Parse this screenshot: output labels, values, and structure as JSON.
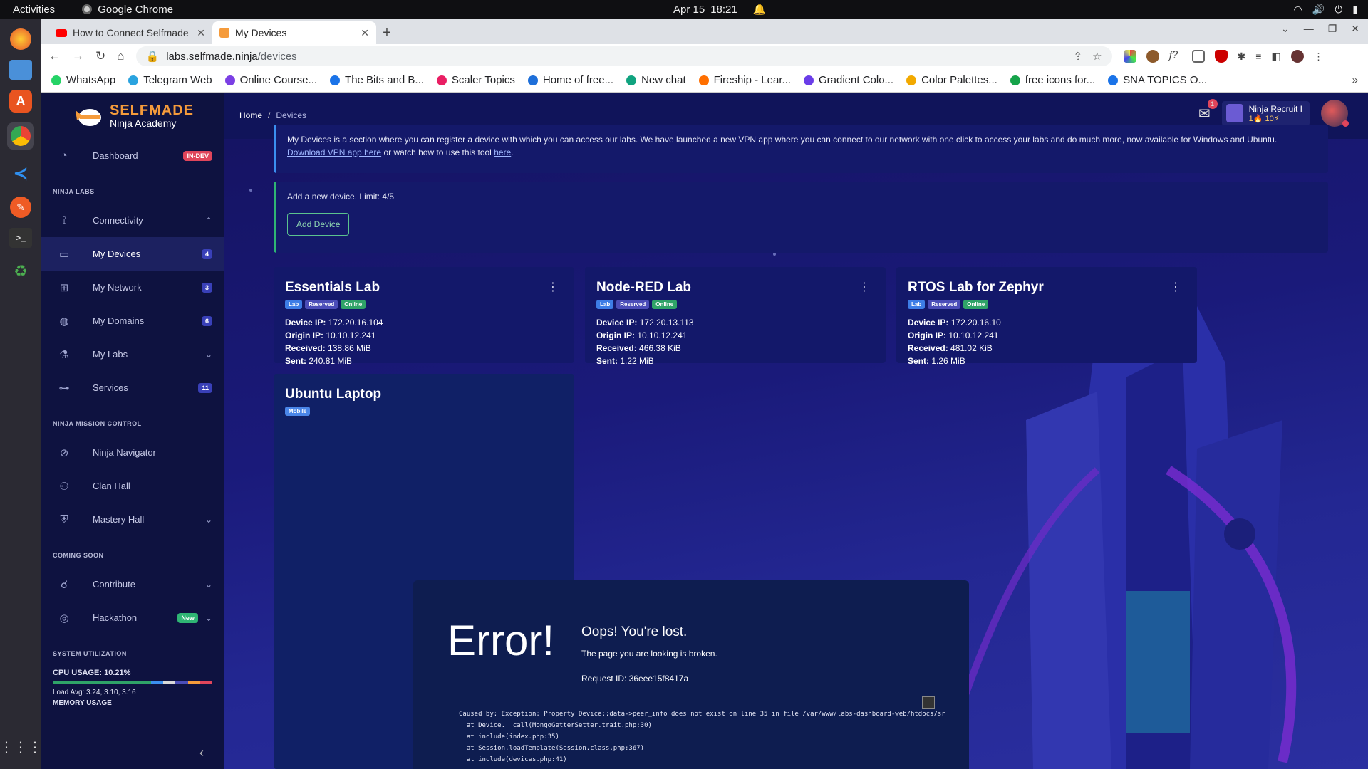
{
  "os": {
    "activities": "Activities",
    "app_name": "Google Chrome",
    "date": "Apr 15",
    "time": "18:21"
  },
  "browser": {
    "tabs": [
      {
        "title": "How to Connect Selfmade",
        "active": false
      },
      {
        "title": "My Devices",
        "active": true
      }
    ],
    "url_host": "labs.selfmade.ninja",
    "url_path": "/devices",
    "bookmarks": [
      {
        "label": "WhatsApp",
        "color": "#25d366"
      },
      {
        "label": "Telegram Web",
        "color": "#2aa3df"
      },
      {
        "label": "Online Course...",
        "color": "#7b3fe4"
      },
      {
        "label": "The Bits and B...",
        "color": "#1a73e8"
      },
      {
        "label": "Scaler Topics",
        "color": "#e91e63"
      },
      {
        "label": "Home of free...",
        "color": "#1e6fd9"
      },
      {
        "label": "New chat",
        "color": "#10a37f"
      },
      {
        "label": "Fireship - Lear...",
        "color": "#ff6f00"
      },
      {
        "label": "Gradient Colo...",
        "color": "#6a3de8"
      },
      {
        "label": "Color Palettes...",
        "color": "#f2a900"
      },
      {
        "label": "free icons for...",
        "color": "#16a34a"
      },
      {
        "label": "SNA TOPICS O...",
        "color": "#1a73e8"
      }
    ]
  },
  "brand": {
    "line1": "SELFMADE",
    "line2": "Ninja Academy"
  },
  "sidebar": {
    "dashboard": {
      "label": "Dashboard",
      "badge": "IN-DEV"
    },
    "section_labs": "NINJA LABS",
    "labs_items": [
      {
        "label": "Connectivity",
        "badge": "",
        "chevron": "⌃"
      },
      {
        "label": "My Devices",
        "badge": "4",
        "chevron": ""
      },
      {
        "label": "My Network",
        "badge": "3",
        "chevron": ""
      },
      {
        "label": "My Domains",
        "badge": "6",
        "chevron": ""
      },
      {
        "label": "My Labs",
        "badge": "",
        "chevron": "⌄"
      },
      {
        "label": "Services",
        "badge": "11",
        "chevron": ""
      }
    ],
    "section_mission": "NINJA MISSION CONTROL",
    "mission_items": [
      {
        "label": "Ninja Navigator"
      },
      {
        "label": "Clan Hall"
      },
      {
        "label": "Mastery Hall"
      }
    ],
    "section_soon": "COMING SOON",
    "soon_items": [
      {
        "label": "Contribute",
        "badge": ""
      },
      {
        "label": "Hackathon",
        "badge": "New"
      }
    ],
    "section_util": "SYSTEM UTILIZATION",
    "cpu_usage": "CPU USAGE: 10.21%",
    "load_avg": "Load Avg: 3.24, 3.10, 3.16",
    "memory": "MEMORY USAGE"
  },
  "header": {
    "crumb_home": "Home",
    "crumb_current": "Devices",
    "mail_count": "1",
    "rank_title": "Ninja Recruit I",
    "rank_stats": "1🔥 10⚡"
  },
  "info": {
    "text": "My Devices is a section where you can register a device with which you can access our labs. We have launched a new VPN app where you can connect to our network with one click to access your labs and do much more, now available for Windows and Ubuntu.",
    "link1": "Download VPN app here",
    "mid": "or watch how to use this tool",
    "link2": "here",
    "end": "."
  },
  "add_device": {
    "text": "Add a new device. Limit: 4/5",
    "button": "Add Device"
  },
  "devices": [
    {
      "name": "Essentials Lab",
      "tags": [
        "Lab",
        "Reserved",
        "Online"
      ],
      "device_ip": "172.20.16.104",
      "origin_ip": "10.10.12.241",
      "received": "138.86 MiB",
      "sent": "240.81 MiB"
    },
    {
      "name": "Node-RED Lab",
      "tags": [
        "Lab",
        "Reserved",
        "Online"
      ],
      "device_ip": "172.20.13.113",
      "origin_ip": "10.10.12.241",
      "received": "466.38 KiB",
      "sent": "1.22 MiB"
    },
    {
      "name": "RTOS Lab for Zephyr",
      "tags": [
        "Lab",
        "Reserved",
        "Online"
      ],
      "device_ip": "172.20.16.10",
      "origin_ip": "10.10.12.241",
      "received": "481.02 KiB",
      "sent": "1.26 MiB"
    },
    {
      "name": "Ubuntu Laptop",
      "tags": [
        "Mobile"
      ]
    }
  ],
  "labels": {
    "device_ip": "Device IP:",
    "origin_ip": "Origin IP:",
    "received": "Received:",
    "sent": "Sent:"
  },
  "error": {
    "big": "Error!",
    "oops": "Oops! You're lost.",
    "broken": "The page you are looking is broken.",
    "request": "Request ID: 36eee15f8417a",
    "trace": [
      "Caused by: Exception: Property Device::data->peer_info does not exist on line 35 in file /var/www/labs-dashboard-web/htdocs/sr",
      "  at Device.__call(MongoGetterSetter.trait.php:30)",
      "  at include(index.php:35)",
      "  at Session.loadTemplate(Session.class.php:367)",
      "  at include(devices.php:41)"
    ]
  }
}
